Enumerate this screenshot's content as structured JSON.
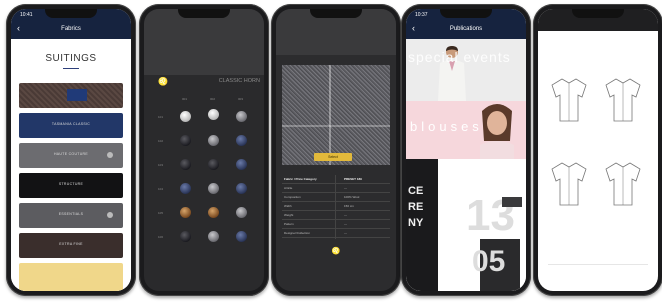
{
  "phone1": {
    "title": "Fabrics",
    "time": "10:41",
    "brand": "SUITINGS",
    "fabrics": [
      {
        "label": "TASMANIA CLASSIC"
      },
      {
        "label": "HAUTE COUTURE"
      },
      {
        "label": "STRUCTURE"
      },
      {
        "label": "ESSENTIALS"
      },
      {
        "label": "EXTRA FINE"
      }
    ]
  },
  "phone2": {
    "logo": "♌",
    "header": "CLASSIC HORN",
    "columns": [
      "001",
      "002",
      "003"
    ],
    "rows": [
      "101",
      "102",
      "103",
      "104",
      "105",
      "106"
    ]
  },
  "phone3": {
    "button": "Select",
    "table": [
      [
        "Fabric / Price Category",
        "PRESET 189"
      ],
      [
        "Article",
        "—"
      ],
      [
        "Composition",
        "100% Wool"
      ],
      [
        "Width",
        "150 cm"
      ],
      [
        "Weight",
        "—"
      ],
      [
        "Pattern",
        "—"
      ],
      [
        "Designer/Collection",
        "—"
      ]
    ],
    "footer_logo": "♌"
  },
  "phone4": {
    "title": "Publications",
    "time": "10:37",
    "overlay1": "special events",
    "overlay2": "blouses",
    "mag_lines": [
      "CE",
      "RE",
      "NY"
    ],
    "big_number": "13",
    "big_number2": "05"
  },
  "phone5": {},
  "colors": {
    "navy": "#16233f",
    "gold": "#f0d78a",
    "dark": "#2c2c2e"
  }
}
